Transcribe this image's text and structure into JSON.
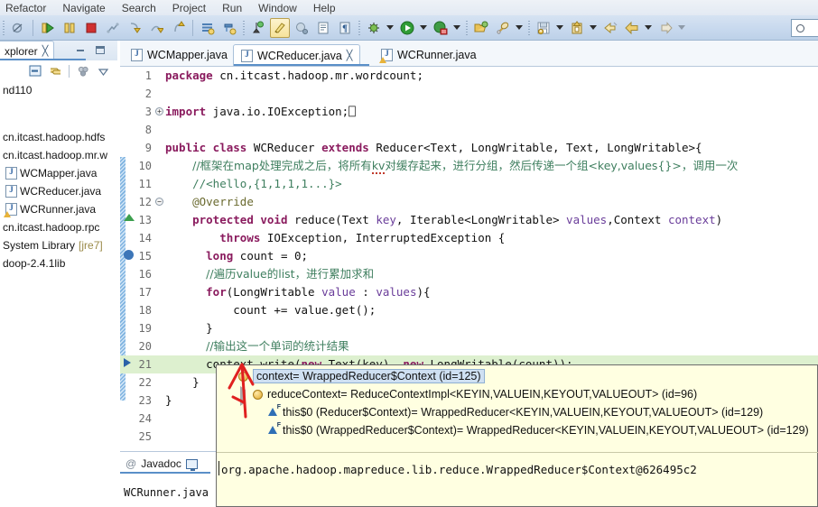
{
  "menu": {
    "items": [
      "Refactor",
      "Navigate",
      "Search",
      "Project",
      "Run",
      "Window",
      "Help"
    ]
  },
  "toolbar": {
    "search_placeholder": "",
    "icons": [
      "toggle-breakpoint-icon",
      "resume-icon",
      "suspend-icon",
      "terminate-icon",
      "disconnect-icon",
      "step-into-icon",
      "step-over-icon",
      "step-return-icon",
      "new-java-class-icon",
      "new-java-project-icon",
      "debug-perspective-icon",
      "toggle-mark-occurrences-icon",
      "open-task-icon",
      "show-whitespace-icon",
      "debug-run-icon",
      "run-icon",
      "external-tools-icon",
      "open-type-icon",
      "search-icon",
      "save-icon",
      "save-all-icon",
      "back-icon",
      "forward-icon",
      "next-annotation-icon"
    ]
  },
  "sidebar": {
    "tab_label": "xplorer",
    "tab_close": "╳",
    "minimize_title": "Minimize",
    "maximize_title": "Maximize",
    "view_buttons": [
      "collapse-all-icon",
      "link-with-editor-icon",
      "filters-icon",
      "view-menu-icon"
    ],
    "tree": [
      {
        "label": "nd110",
        "icon": "project-icon",
        "indent": 0,
        "warn": false
      },
      {
        "label": "cn.itcast.hadoop.hdfs",
        "icon": "package-icon",
        "indent": 0,
        "warn": false
      },
      {
        "label": "cn.itcast.hadoop.mr.w",
        "icon": "package-icon",
        "indent": 0,
        "warn": false
      },
      {
        "label": "WCMapper.java",
        "icon": "java-file-icon",
        "indent": 1,
        "warn": false
      },
      {
        "label": "WCReducer.java",
        "icon": "java-file-icon",
        "indent": 1,
        "warn": false
      },
      {
        "label": "WCRunner.java",
        "icon": "java-file-icon",
        "indent": 1,
        "warn": true
      },
      {
        "label": "cn.itcast.hadoop.rpc",
        "icon": "package-icon",
        "indent": 0,
        "warn": false
      },
      {
        "label": "System Library",
        "icon": "library-icon",
        "indent": 0,
        "warn": false,
        "suffix": "[jre7]"
      },
      {
        "label": "doop-2.4.1lib",
        "icon": "library-icon",
        "indent": 0,
        "warn": false
      }
    ]
  },
  "editor": {
    "tabs": [
      {
        "label": "WCMapper.java",
        "active": false,
        "closable": false,
        "icon": "java-file-icon"
      },
      {
        "label": "WCReducer.java",
        "active": true,
        "closable": true,
        "icon": "java-file-icon"
      },
      {
        "label": "WCRunner.java",
        "active": false,
        "closable": false,
        "icon": "java-file-icon-warn"
      }
    ],
    "close_glyph": "╳",
    "lines": [
      {
        "no": "1",
        "marker": "",
        "fold": "",
        "highlight": false,
        "html": "<span class=\"kw\">package</span> <span class=\"pkg\">cn.itcast.hadoop.mr.wordcount;</span>"
      },
      {
        "no": "2",
        "marker": "",
        "fold": "",
        "highlight": false,
        "html": ""
      },
      {
        "no": "3",
        "marker": "",
        "fold": "plus",
        "highlight": false,
        "html": "<span class=\"kw\">import</span> java.io.IOException;⎕"
      },
      {
        "no": "8",
        "marker": "",
        "fold": "",
        "highlight": false,
        "html": ""
      },
      {
        "no": "9",
        "marker": "",
        "fold": "",
        "highlight": false,
        "html": "<span class=\"kw\">public class</span> WCReducer <span class=\"kw\">extends</span> Reducer&lt;Text, LongWritable, Text, LongWritable&gt;{"
      },
      {
        "no": "10",
        "marker": "",
        "fold": "",
        "highlight": false,
        "html": "&nbsp;&nbsp;&nbsp;&nbsp;<span class=\"cmt cmt-cjk\">//框架在map处理完成之后，将所有<span class=\"squig\">kv</span>对缓存起来，进行分组，然后传递一个组&lt;key,values{}&gt;，调用一次</span>"
      },
      {
        "no": "11",
        "marker": "",
        "fold": "",
        "highlight": false,
        "html": "&nbsp;&nbsp;&nbsp;&nbsp;<span class=\"cmt\">//&lt;hello,{1,1,1,1...}&gt;</span>"
      },
      {
        "no": "12",
        "marker": "",
        "fold": "minus",
        "highlight": false,
        "html": "&nbsp;&nbsp;&nbsp;&nbsp;<span class=\"ann\">@Override</span>"
      },
      {
        "no": "13",
        "marker": "tri-up",
        "fold": "",
        "highlight": false,
        "html": "&nbsp;&nbsp;&nbsp;&nbsp;<span class=\"kw\">protected void</span> reduce(Text <span class=\"loc\">key</span>, Iterable&lt;LongWritable&gt; <span class=\"loc\">values</span>,Context <span class=\"loc\">context</span>)"
      },
      {
        "no": "14",
        "marker": "",
        "fold": "",
        "highlight": false,
        "html": "&nbsp;&nbsp;&nbsp;&nbsp;&nbsp;&nbsp;&nbsp;&nbsp;<span class=\"kw\">throws</span> IOException, InterruptedException {"
      },
      {
        "no": "15",
        "marker": "bulb",
        "fold": "",
        "highlight": false,
        "html": "&nbsp;&nbsp;&nbsp;&nbsp;&nbsp;&nbsp;<span class=\"kw\">long</span> count = 0;"
      },
      {
        "no": "16",
        "marker": "",
        "fold": "",
        "highlight": false,
        "html": "&nbsp;&nbsp;&nbsp;&nbsp;&nbsp;&nbsp;<span class=\"cmt cmt-cjk\">//遍历value的list，进行累加求和</span>"
      },
      {
        "no": "17",
        "marker": "",
        "fold": "",
        "highlight": false,
        "html": "&nbsp;&nbsp;&nbsp;&nbsp;&nbsp;&nbsp;<span class=\"kw\">for</span>(LongWritable <span class=\"loc\">value</span> : <span class=\"loc\">values</span>){"
      },
      {
        "no": "18",
        "marker": "",
        "fold": "",
        "highlight": false,
        "html": "&nbsp;&nbsp;&nbsp;&nbsp;&nbsp;&nbsp;&nbsp;&nbsp;&nbsp;&nbsp;count += value.get();"
      },
      {
        "no": "19",
        "marker": "",
        "fold": "",
        "highlight": false,
        "html": "&nbsp;&nbsp;&nbsp;&nbsp;&nbsp;&nbsp;}"
      },
      {
        "no": "20",
        "marker": "",
        "fold": "",
        "highlight": false,
        "html": "&nbsp;&nbsp;&nbsp;&nbsp;&nbsp;&nbsp;<span class=\"cmt cmt-cjk\">//输出这一个单词的统计结果</span>"
      },
      {
        "no": "21",
        "marker": "arr-right",
        "fold": "",
        "highlight": true,
        "html": "&nbsp;&nbsp;&nbsp;&nbsp;&nbsp;&nbsp;context.write(<span class=\"kw\">new</span> Text(key), <span class=\"kw\">new</span> LongWritable(count));"
      },
      {
        "no": "22",
        "marker": "",
        "fold": "",
        "highlight": false,
        "html": "&nbsp;&nbsp;&nbsp;&nbsp;}"
      },
      {
        "no": "23",
        "marker": "",
        "fold": "",
        "highlight": false,
        "html": "}"
      },
      {
        "no": "24",
        "marker": "",
        "fold": "",
        "highlight": false,
        "html": ""
      },
      {
        "no": "25",
        "marker": "",
        "fold": "",
        "highlight": false,
        "html": ""
      }
    ]
  },
  "bottom_view": {
    "tab_label": "Javadoc",
    "at_glyph": "@",
    "monitor_icon": "declaration-view-icon",
    "content": "WCRunner.java"
  },
  "popup": {
    "rows": [
      {
        "indent": 1,
        "expander": "expanded",
        "icon": "object-value-icon",
        "text": "context= WrappedReducer$Context  (id=125)",
        "selected": true
      },
      {
        "indent": 2,
        "expander": "collapsed",
        "icon": "object-value-icon",
        "text": "reduceContext= ReduceContextImpl<KEYIN,VALUEIN,KEYOUT,VALUEOUT>  (id=96)",
        "selected": false
      },
      {
        "indent": 3,
        "expander": "none",
        "icon": "field-icon",
        "text": "this$0 (Reducer$Context)= WrappedReducer<KEYIN,VALUEIN,KEYOUT,VALUEOUT>  (id=129)",
        "selected": false
      },
      {
        "indent": 3,
        "expander": "none",
        "icon": "field-icon",
        "text": "this$0 (WrappedReducer$Context)= WrappedReducer<KEYIN,VALUEIN,KEYOUT,VALUEOUT>  (id=129)",
        "selected": false
      }
    ],
    "detail": "org.apache.hadoop.mapreduce.lib.reduce.WrappedReducer$Context@626495c2"
  },
  "annotation": {
    "shape": "red-arrow-pointing-up",
    "color": "#e02020"
  },
  "colors": {
    "toolbar_bg": "#c8d9ee",
    "tab_underline": "#5a8fc8",
    "highlight_line": "#ddf0cf",
    "popup_bg": "#ffffe1",
    "keyword": "#8a1b5e",
    "comment": "#3f7f5f",
    "annotation_red": "#e02020"
  }
}
